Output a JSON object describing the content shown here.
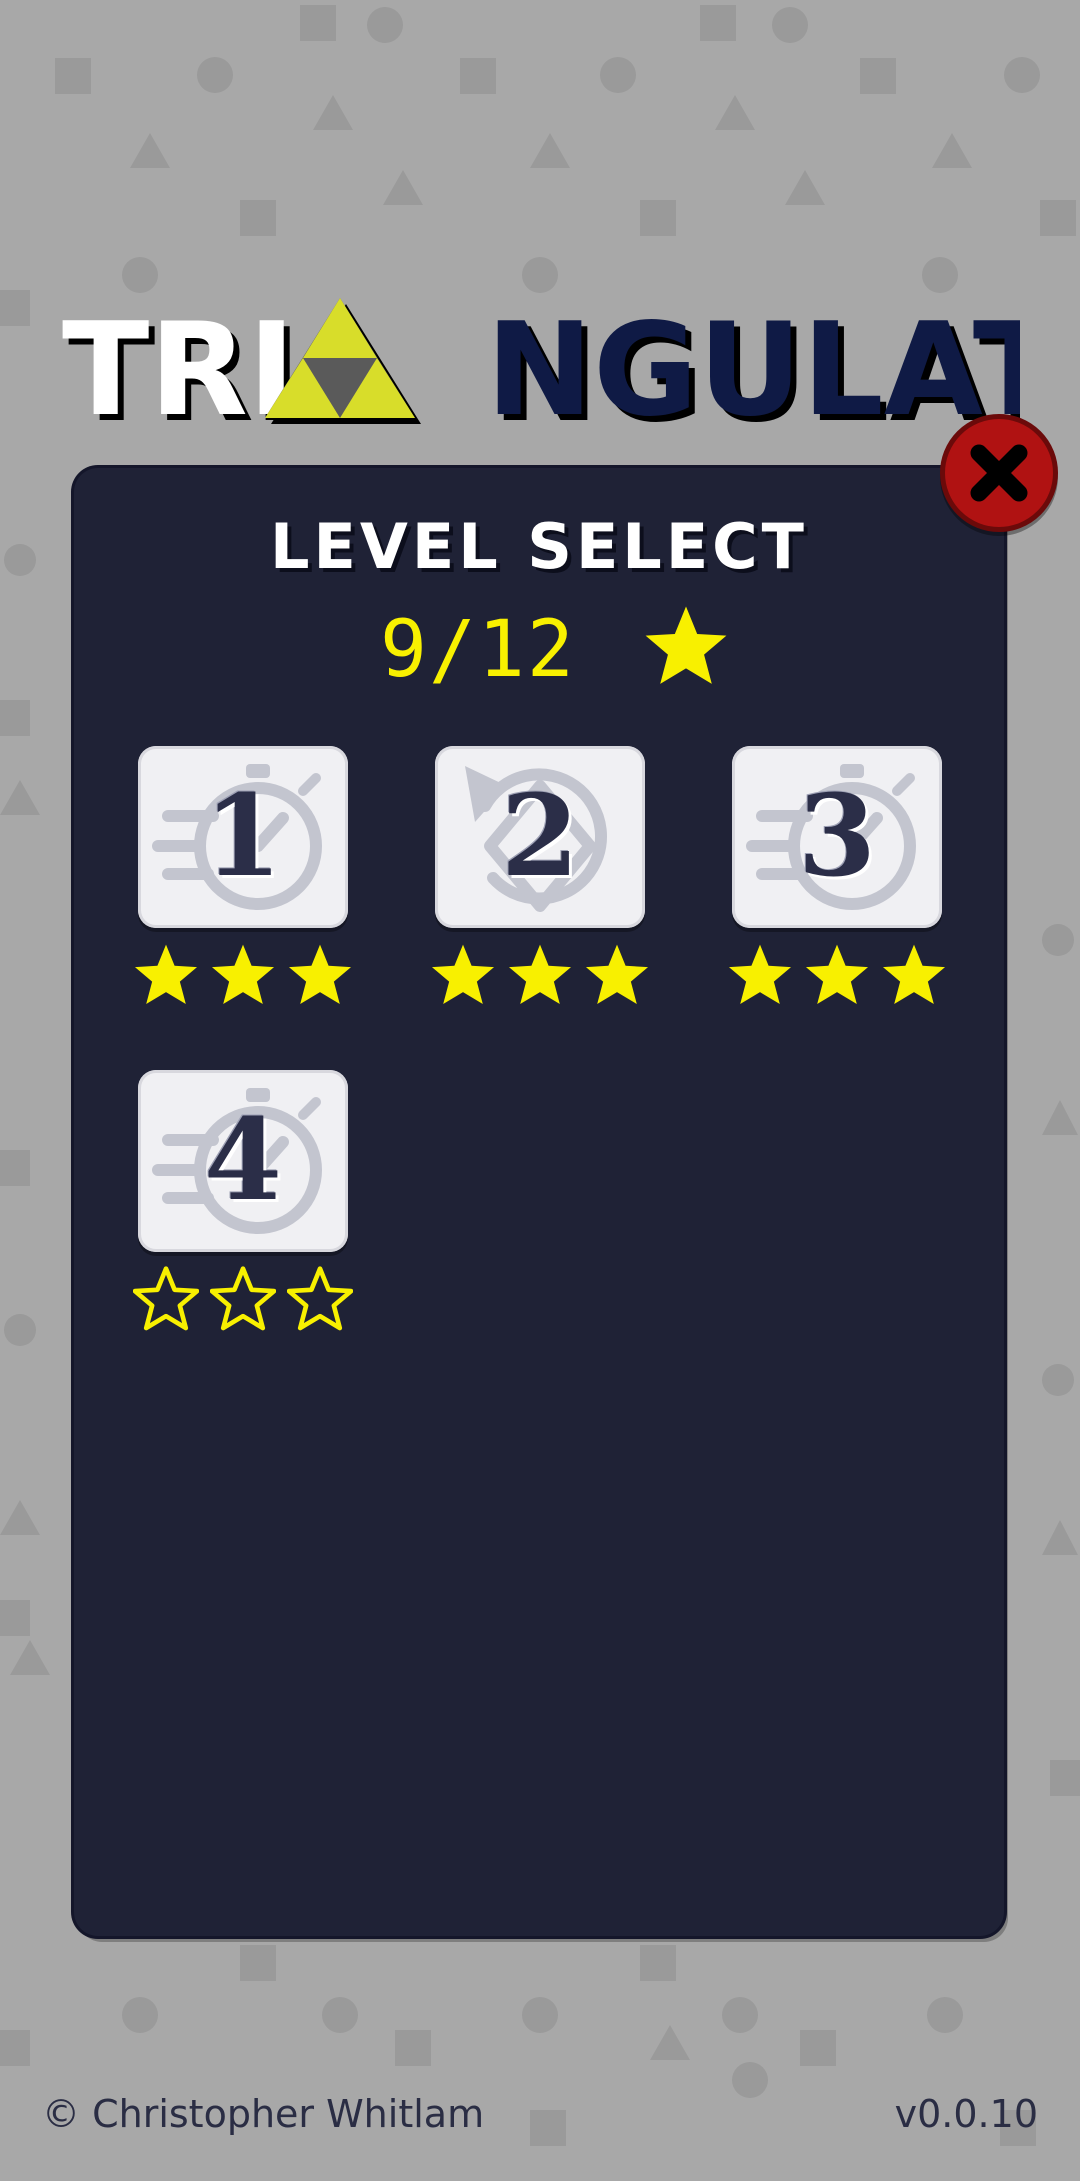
{
  "app": {
    "title_left": "TRI",
    "title_right": "NGULATE"
  },
  "panel": {
    "title": "LEVEL SELECT",
    "score": "9/12"
  },
  "levels": [
    {
      "number": "1",
      "stars_earned": 3,
      "stars_total": 3,
      "icon": "stopwatch-icon"
    },
    {
      "number": "2",
      "stars_earned": 3,
      "stars_total": 3,
      "icon": "rotate-icon"
    },
    {
      "number": "3",
      "stars_earned": 3,
      "stars_total": 3,
      "icon": "stopwatch-icon"
    },
    {
      "number": "4",
      "stars_earned": 0,
      "stars_total": 3,
      "icon": "stopwatch-icon"
    }
  ],
  "footer": {
    "copyright": "© Christopher Whitlam",
    "version": "v0.0.10"
  },
  "colors": {
    "background": "#a8a8a8",
    "panel": "#1f2236",
    "star": "#f8f000",
    "close": "#b01212",
    "logo_dark": "#0f1a45",
    "logo_tri": "#d8dd2a"
  }
}
